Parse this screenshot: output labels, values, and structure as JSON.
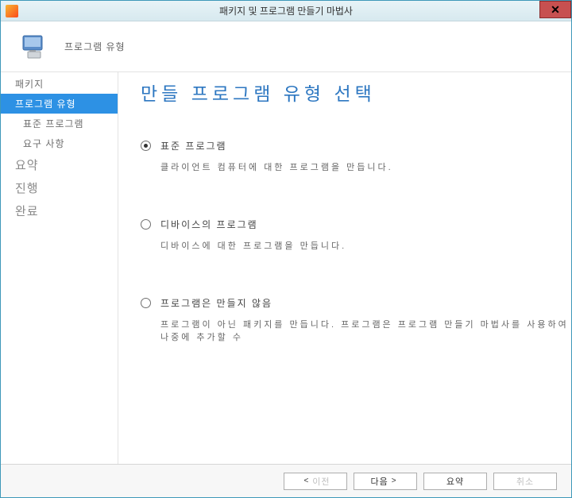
{
  "titlebar": {
    "title": "패키지 및 프로그램 만들기 마법사"
  },
  "header": {
    "label": "프로그램 유형"
  },
  "sidebar": {
    "items": [
      {
        "label": "패키지",
        "type": "item"
      },
      {
        "label": "프로그램 유형",
        "type": "item",
        "selected": true
      },
      {
        "label": "표준 프로그램",
        "type": "sub"
      },
      {
        "label": "요구 사항",
        "type": "sub"
      },
      {
        "label": "요약",
        "type": "section"
      },
      {
        "label": "진행",
        "type": "section"
      },
      {
        "label": "완료",
        "type": "section"
      }
    ]
  },
  "main": {
    "title": "만들 프로그램 유형 선택",
    "options": [
      {
        "label": "표준 프로그램",
        "desc": "클라이언트 컴퓨터에 대한 프로그램을 만듭니다.",
        "checked": true
      },
      {
        "label": "디바이스의 프로그램",
        "desc": "디바이스에 대한 프로그램을 만듭니다.",
        "checked": false
      },
      {
        "label": "프로그램은 만들지 않음",
        "desc": "프로그램이 아닌 패키지를 만듭니다. 프로그램은 프로그램 만들기 마법사를 사용하여 나중에 추가할 수",
        "checked": false
      }
    ]
  },
  "footer": {
    "prev": "이전",
    "next": "다음",
    "summary": "요약",
    "cancel": "취소"
  }
}
